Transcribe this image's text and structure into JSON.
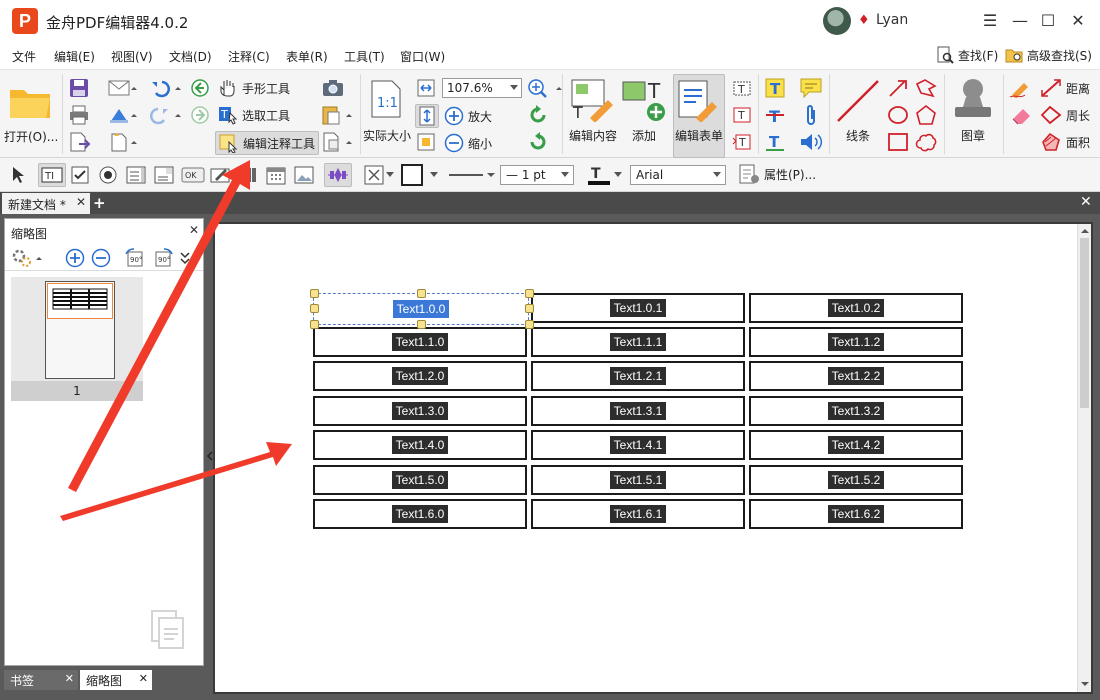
{
  "app": {
    "title": "金舟PDF编辑器4.0.2",
    "logo_letter": "P",
    "user_name": "Lyan"
  },
  "menu": [
    "文件",
    "编辑(E)",
    "视图(V)",
    "文档(D)",
    "注释(C)",
    "表单(R)",
    "工具(T)",
    "窗口(W)"
  ],
  "search": {
    "find": "查找(F)",
    "advanced_find": "高级查找(S)"
  },
  "ribbon": {
    "open": "打开(O)...",
    "hand_tool": "手形工具",
    "select_tool": "选取工具",
    "edit_annot_tool": "编辑注释工具",
    "actual_size": "实际大小",
    "zoom_value": "107.6%",
    "zoom_in": "放大",
    "zoom_out": "缩小",
    "edit_content": "编辑内容",
    "add": "添加",
    "edit_form": "编辑表单",
    "lines": "线条",
    "stamp": "图章",
    "distance": "距离",
    "perimeter": "周长",
    "area": "面积"
  },
  "format": {
    "line_width": "— 1 pt",
    "font": "Arial",
    "properties": "属性(P)..."
  },
  "doc": {
    "tab_label": "新建文档 *"
  },
  "panel": {
    "title": "缩略图",
    "page_number": "1",
    "tab_bookmarks": "书签",
    "tab_thumbnails": "缩略图"
  },
  "table": {
    "rows": [
      [
        "Text1.0.0",
        "Text1.0.1",
        "Text1.0.2"
      ],
      [
        "Text1.1.0",
        "Text1.1.1",
        "Text1.1.2"
      ],
      [
        "Text1.2.0",
        "Text1.2.1",
        "Text1.2.2"
      ],
      [
        "Text1.3.0",
        "Text1.3.1",
        "Text1.3.2"
      ],
      [
        "Text1.4.0",
        "Text1.4.1",
        "Text1.4.2"
      ],
      [
        "Text1.5.0",
        "Text1.5.1",
        "Text1.5.2"
      ],
      [
        "Text1.6.0",
        "Text1.6.1",
        "Text1.6.2"
      ]
    ],
    "selected": "Text1.0.0"
  },
  "colors": {
    "brand": "#e8481c",
    "annotation_arrow": "#f03a2a",
    "field_fill": "#2d2d2d",
    "selection": "#3b78d8"
  }
}
